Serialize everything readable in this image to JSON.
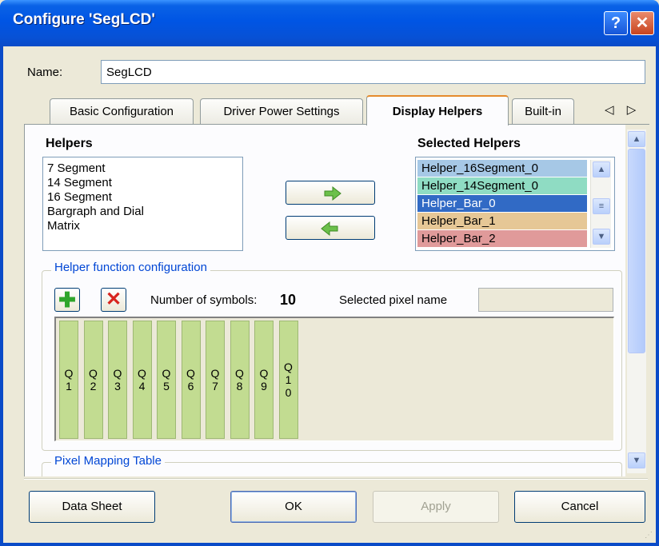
{
  "window": {
    "title": "Configure 'SegLCD'",
    "help_glyph": "?",
    "close_glyph": "✕"
  },
  "name_field": {
    "label": "Name:",
    "value": "SegLCD"
  },
  "tabs": [
    {
      "label": "Basic Configuration"
    },
    {
      "label": "Driver Power Settings"
    },
    {
      "label": "Display Helpers",
      "active": true
    },
    {
      "label": "Built-in"
    }
  ],
  "tab_scroll": "◁ ▷",
  "helpers": {
    "label": "Helpers",
    "items": [
      "7 Segment",
      "14 Segment",
      "16 Segment",
      "Bargraph and Dial",
      "Matrix"
    ]
  },
  "transfer": {
    "right_icon": "right-arrow-icon",
    "left_icon": "left-arrow-icon",
    "right_glyph": "➡",
    "left_glyph": "⬅"
  },
  "selected_helpers": {
    "label": "Selected Helpers",
    "items": [
      {
        "label": "Helper_16Segment_0",
        "color": "#a6c8e6"
      },
      {
        "label": "Helper_14Segment_0",
        "color": "#8fdcc3"
      },
      {
        "label": "Helper_Bar_0",
        "color": "#316ac5",
        "text_color": "#ffffff"
      },
      {
        "label": "Helper_Bar_1",
        "color": "#e6c796"
      },
      {
        "label": "Helper_Bar_2",
        "color": "#e09a9a"
      }
    ]
  },
  "helper_config": {
    "legend": "Helper function configuration",
    "add_glyph": "✚",
    "delete_glyph": "✕",
    "symbols_label": "Number of symbols:",
    "symbols_value": "10",
    "pixel_name_label": "Selected pixel name",
    "pixel_name_value": "",
    "symbols": [
      "Q\n1",
      "Q\n2",
      "Q\n3",
      "Q\n4",
      "Q\n5",
      "Q\n6",
      "Q\n7",
      "Q\n8",
      "Q\n9",
      "Q\n1\n0"
    ],
    "symbol_color": "#c2dc91"
  },
  "pixel_mapping": {
    "legend": "Pixel Mapping Table"
  },
  "buttons": {
    "datasheet": "Data Sheet",
    "ok": "OK",
    "apply": "Apply",
    "cancel": "Cancel"
  },
  "scroll": {
    "up": "▲",
    "down": "▼",
    "grip": "≡"
  }
}
